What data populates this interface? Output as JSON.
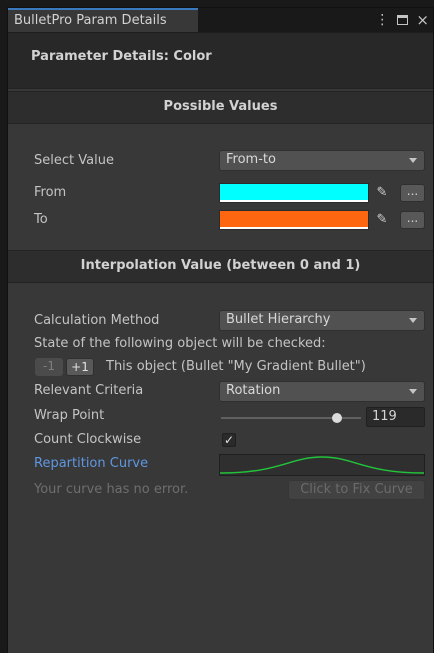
{
  "window": {
    "tab_title": "BulletPro Param Details"
  },
  "panel": {
    "title": "Parameter Details: Color"
  },
  "possible_values": {
    "header": "Possible Values",
    "select_value_label": "Select Value",
    "select_value": "From-to",
    "from_label": "From",
    "from_color": "#00ffff",
    "to_label": "To",
    "to_color": "#ff6610",
    "more_label": "..."
  },
  "interpolation": {
    "header": "Interpolation Value (between 0 and 1)",
    "calculation_method_label": "Calculation Method",
    "calculation_method": "Bullet Hierarchy",
    "state_text": "State of the following object will be checked:",
    "minus_label": "-1",
    "plus_label": "+1",
    "object_text": "This object (Bullet \"My Gradient Bullet\")",
    "relevant_criteria_label": "Relevant Criteria",
    "relevant_criteria": "Rotation",
    "wrap_point_label": "Wrap Point",
    "wrap_point_value": "119",
    "wrap_point_slider_fraction": 0.83,
    "count_clockwise_label": "Count Clockwise",
    "count_clockwise_checked": true,
    "repartition_curve_label": "Repartition Curve",
    "curve_color": "#22c33a",
    "curve_status": "Your curve has no error.",
    "fix_curve_label": "Click to Fix Curve"
  }
}
